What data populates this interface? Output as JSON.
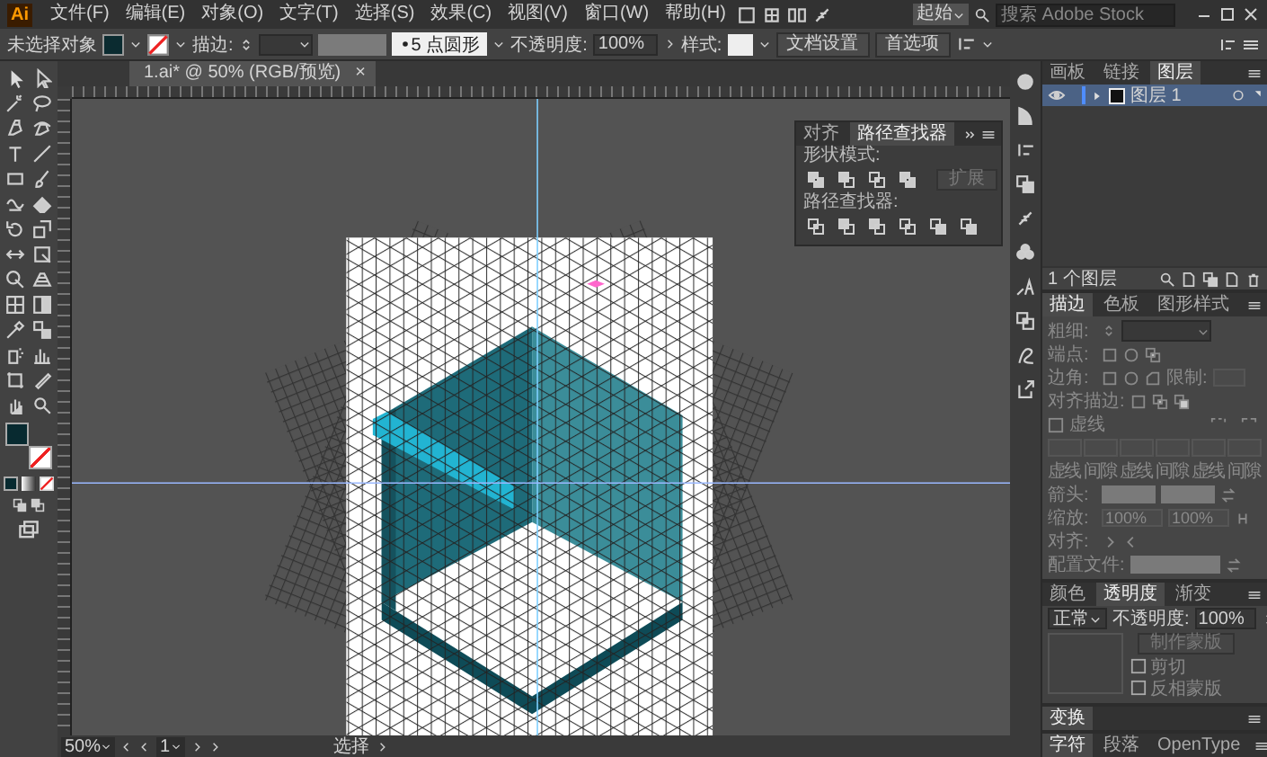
{
  "menu": {
    "logo": "Ai",
    "items": [
      "文件(F)",
      "编辑(E)",
      "对象(O)",
      "文字(T)",
      "选择(S)",
      "效果(C)",
      "视图(V)",
      "窗口(W)",
      "帮助(H)"
    ],
    "workspace": "起始",
    "search_placeholder": "搜索 Adobe Stock"
  },
  "control_bar": {
    "selection": "未选择对象",
    "stroke_label": "描边:",
    "brush": "5 点圆形",
    "opacity_label": "不透明度:",
    "opacity": "100%",
    "style_label": "样式:",
    "buttons": [
      "文档设置",
      "首选项"
    ]
  },
  "document_tab": {
    "title": "1.ai* @ 50% (RGB/预览)",
    "close": "×"
  },
  "pathfinder_panel": {
    "tabs": [
      {
        "label": "对齐",
        "selected": false
      },
      {
        "label": "路径查找器",
        "selected": true
      }
    ],
    "shape_modes_label": "形状模式:",
    "expand": {
      "label": "扩展",
      "disabled": true
    },
    "pathfinders_label": "路径查找器:"
  },
  "layers_panel": {
    "tabs": [
      {
        "label": "画板",
        "selected": false
      },
      {
        "label": "链接",
        "selected": false
      },
      {
        "label": "图层",
        "selected": true
      }
    ],
    "layers": [
      {
        "name": "图层 1",
        "visible": true,
        "selected": true
      }
    ],
    "count": "1 个图层"
  },
  "stroke_panel": {
    "disabled": true,
    "tabs": [
      {
        "label": "描边",
        "selected": true
      },
      {
        "label": "色板",
        "selected": false
      },
      {
        "label": "图形样式",
        "selected": false
      }
    ],
    "weight_label": "粗细:",
    "cap_label": "端点:",
    "corner_label": "边角:",
    "limit_label": "限制:",
    "align_label": "对齐描边:",
    "dashed": {
      "label": "虚线",
      "checked": false
    },
    "dash_labels": [
      "虚线",
      "间隙",
      "虚线",
      "间隙",
      "虚线",
      "间隙"
    ],
    "arrow_label": "箭头:",
    "scale_label": "缩放:",
    "scale_values": [
      "100%",
      "100%"
    ],
    "align2_label": "对齐:",
    "profile_label": "配置文件:"
  },
  "transparency_panel": {
    "tabs": [
      {
        "label": "颜色",
        "selected": false
      },
      {
        "label": "透明度",
        "selected": true
      },
      {
        "label": "渐变",
        "selected": false
      }
    ],
    "blend_mode": "正常",
    "opacity_label": "不透明度:",
    "opacity": "100%",
    "mask_button": "制作蒙版",
    "options": [
      {
        "label": "剪切",
        "checked": false
      },
      {
        "label": "反相蒙版",
        "checked": false
      }
    ]
  },
  "collapsed_panels": [
    {
      "tabs": [
        {
          "label": "变换",
          "selected": true
        }
      ]
    },
    {
      "tabs": [
        {
          "label": "字符",
          "selected": true
        },
        {
          "label": "段落",
          "selected": false
        },
        {
          "label": "OpenType",
          "selected": false
        }
      ]
    }
  ],
  "status_bar": {
    "zoom": "50%",
    "artboard": "1",
    "tool": "选择"
  }
}
